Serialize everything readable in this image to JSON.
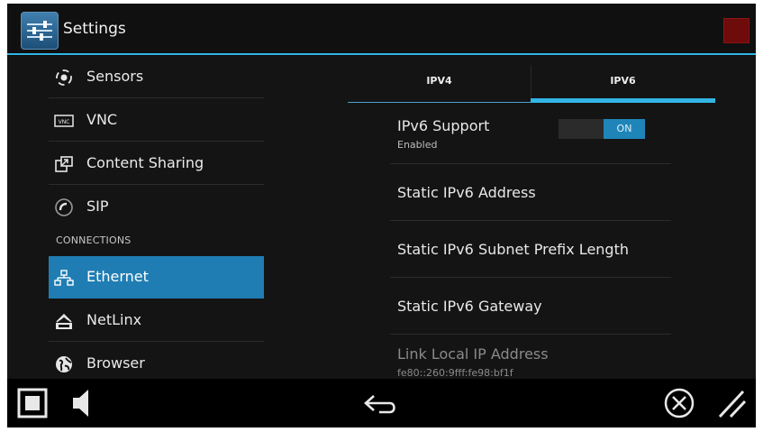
{
  "app": {
    "title": "Settings",
    "icon": "settings-sliders-icon"
  },
  "sidebar": {
    "items": [
      {
        "label": "Sensors",
        "icon": "sensors-icon"
      },
      {
        "label": "VNC",
        "icon": "vnc-icon"
      },
      {
        "label": "Content Sharing",
        "icon": "content-sharing-icon"
      },
      {
        "label": "SIP",
        "icon": "sip-icon"
      },
      {
        "label": "Ethernet",
        "icon": "ethernet-icon",
        "selected": true
      },
      {
        "label": "NetLinx",
        "icon": "netlinx-icon"
      },
      {
        "label": "Browser",
        "icon": "browser-icon"
      }
    ],
    "section_header": "CONNECTIONS"
  },
  "tabs": [
    {
      "label": "IPV4",
      "active": false
    },
    {
      "label": "IPV6",
      "active": true
    }
  ],
  "settings": {
    "ipv6_support": {
      "title": "IPv6 Support",
      "summary": "Enabled",
      "toggle_label": "ON"
    },
    "static_address": {
      "title": "Static IPv6 Address"
    },
    "static_prefix": {
      "title": "Static IPv6 Subnet Prefix Length"
    },
    "static_gateway": {
      "title": "Static IPv6 Gateway"
    },
    "link_local": {
      "title": "Link Local IP Address",
      "value": "fe80::260:9fff:fe98:bf1f"
    }
  },
  "navbar": {
    "buttons": [
      "stop-square-icon",
      "volume-icon",
      "back-icon",
      "close-circle-icon",
      "resize-handle-icon"
    ]
  },
  "colors": {
    "accent": "#33b5e5",
    "selected": "#1f7db3",
    "status_square": "#6e0b0b"
  }
}
